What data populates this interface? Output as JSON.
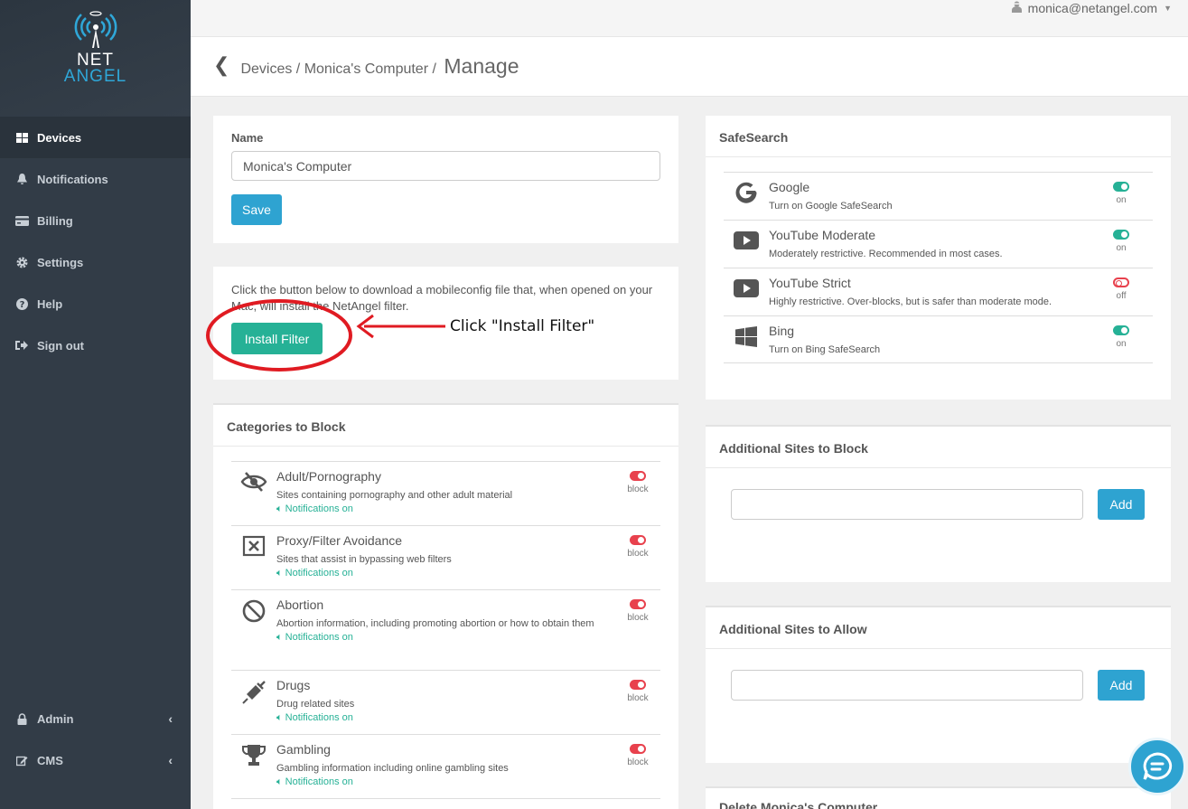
{
  "brand": {
    "line1": "NET",
    "line2": "ANGEL"
  },
  "sidebar": {
    "items": [
      {
        "label": "Devices",
        "icon": "grid-icon"
      },
      {
        "label": "Notifications",
        "icon": "bell-icon"
      },
      {
        "label": "Billing",
        "icon": "credit-card-icon"
      },
      {
        "label": "Settings",
        "icon": "gear-icon"
      },
      {
        "label": "Help",
        "icon": "question-icon"
      },
      {
        "label": "Sign out",
        "icon": "sign-out-icon"
      }
    ],
    "bottom": [
      {
        "label": "Admin",
        "icon": "lock-icon"
      },
      {
        "label": "CMS",
        "icon": "edit-icon"
      }
    ]
  },
  "topbar": {
    "user_email": "monica@netangel.com"
  },
  "breadcrumb": {
    "devices": "Devices",
    "sep1": "/",
    "device": "Monica's Computer",
    "sep2": "/",
    "current": "Manage"
  },
  "name_panel": {
    "label": "Name",
    "value": "Monica's Computer",
    "save": "Save"
  },
  "install_panel": {
    "description": "Click the button below to download a mobileconfig file that, when opened on your Mac, will install the NetAngel filter.",
    "button": "Install Filter",
    "annotation": "Click \"Install Filter\""
  },
  "categories": {
    "title": "Categories to Block",
    "items": [
      {
        "name": "Adult/Pornography",
        "desc": "Sites containing pornography and other adult material",
        "notif": "Notifications on",
        "state": "block",
        "icon": "eye-slash-icon"
      },
      {
        "name": "Proxy/Filter Avoidance",
        "desc": "Sites that assist in bypassing web filters",
        "notif": "Notifications on",
        "state": "block",
        "icon": "x-square-icon"
      },
      {
        "name": "Abortion",
        "desc": "Abortion information, including promoting abortion or how to obtain them",
        "notif": "Notifications on",
        "state": "block",
        "icon": "ban-icon"
      },
      {
        "name": "Drugs",
        "desc": "Drug related sites",
        "notif": "Notifications on",
        "state": "block",
        "icon": "syringe-icon"
      },
      {
        "name": "Gambling",
        "desc": "Gambling information including online gambling sites",
        "notif": "Notifications on",
        "state": "block",
        "icon": "trophy-icon"
      }
    ]
  },
  "safesearch": {
    "title": "SafeSearch",
    "items": [
      {
        "name": "Google",
        "desc": "Turn on Google SafeSearch",
        "state": "on",
        "icon": "google-icon"
      },
      {
        "name": "YouTube Moderate",
        "desc": "Moderately restrictive. Recommended in most cases.",
        "state": "on",
        "icon": "youtube-icon"
      },
      {
        "name": "YouTube Strict",
        "desc": "Highly restrictive. Over-blocks, but is safer than moderate mode.",
        "state": "off",
        "icon": "youtube-icon"
      },
      {
        "name": "Bing",
        "desc": "Turn on Bing SafeSearch",
        "state": "on",
        "icon": "windows-icon"
      }
    ]
  },
  "block_sites": {
    "title": "Additional Sites to Block",
    "button": "Add"
  },
  "allow_sites": {
    "title": "Additional Sites to Allow",
    "button": "Add"
  },
  "delete_panel": {
    "title": "Delete Monica's Computer"
  },
  "colors": {
    "sidebar": "#323c47",
    "accent_blue": "#2ea3d1",
    "accent_green": "#26b196",
    "block_red": "#e8414d",
    "annotation_red": "#e01b22"
  }
}
